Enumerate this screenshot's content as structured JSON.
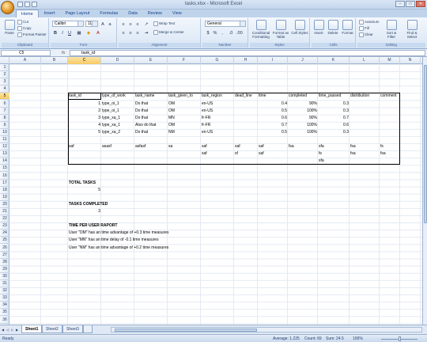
{
  "window": {
    "title": "tasks.xlsx - Microsoft Excel"
  },
  "ribbon_tabs": [
    "Home",
    "Insert",
    "Page Layout",
    "Formulas",
    "Data",
    "Review",
    "View"
  ],
  "active_tab": "Home",
  "ribbon": {
    "clipboard": {
      "paste": "Paste",
      "cut": "Cut",
      "copy": "Copy",
      "format_painter": "Format Painter",
      "label": "Clipboard"
    },
    "font": {
      "name": "Calibri",
      "size": "11",
      "label": "Font"
    },
    "alignment": {
      "wrap_text": "Wrap Text",
      "merge_center": "Merge & Center",
      "label": "Alignment"
    },
    "number": {
      "format": "General",
      "label": "Number"
    },
    "styles": {
      "conditional": "Conditional Formatting",
      "format_table": "Format as Table",
      "cell_styles": "Cell Styles",
      "label": "Styles"
    },
    "cells": {
      "insert": "Insert",
      "delete": "Delete",
      "format": "Format",
      "label": "Cells"
    },
    "editing": {
      "autosum": "AutoSum",
      "fill": "Fill",
      "clear": "Clear",
      "sort_filter": "Sort & Filter",
      "find_select": "Find & Select",
      "label": "Editing"
    }
  },
  "formula_bar": {
    "name_box": "C5",
    "fx": "fx",
    "content": "task_id"
  },
  "columns": [
    "A",
    "B",
    "C",
    "D",
    "E",
    "F",
    "G",
    "H",
    "I",
    "J",
    "K",
    "L",
    "M",
    "N",
    "O"
  ],
  "selected_column": "C",
  "selected_row": 5,
  "rows": [
    "1",
    "2",
    "3",
    "4",
    "5",
    "6",
    "7",
    "8",
    "9",
    "10",
    "11",
    "12",
    "13",
    "14",
    "15",
    "16",
    "17",
    "18",
    "19",
    "20",
    "21",
    "22",
    "23",
    "24",
    "25",
    "26",
    "27",
    "28",
    "29",
    "30",
    "31",
    "32",
    "33",
    "34",
    "35",
    "36"
  ],
  "cells": {
    "r5": [
      "task_id",
      "type_of_work",
      "task_name",
      "task_given_to",
      "task_region",
      "dead_line",
      "time",
      "completed",
      "time_passed",
      "distribution",
      "comment"
    ],
    "r6": [
      "1",
      "type_oi_1",
      "Do that",
      "OM",
      "en-US",
      "",
      "0.4",
      "90%",
      "0.3",
      "",
      ""
    ],
    "r7": [
      "2",
      "type_oi_1",
      "Do that",
      "OM",
      "en-US",
      "",
      "0.5",
      "100%",
      "0.3",
      "",
      ""
    ],
    "r8": [
      "3",
      "type_xa_1",
      "Do that",
      "MN",
      "fr-FR",
      "",
      "0.6",
      "90%",
      "0.7",
      "",
      ""
    ],
    "r9": [
      "4",
      "type_xa_1",
      "Also do that",
      "OM",
      "fr-FR",
      "",
      "0.7",
      "100%",
      "0.6",
      "",
      ""
    ],
    "r10": [
      "5",
      "type_xa_2",
      "Do that",
      "NM",
      "en-US",
      "",
      "0.5",
      "100%",
      "0.3",
      "",
      ""
    ],
    "r12": [
      "saf",
      "asasf",
      "asfasf",
      "sa",
      "saf",
      "saf",
      "saf",
      "fsa",
      "sfa",
      "fsa",
      "fs"
    ],
    "r13": [
      "",
      "",
      "",
      "",
      "saf",
      "sf",
      "saf",
      "",
      "fs",
      "fsa",
      "fsa"
    ],
    "r14": [
      "",
      "",
      "",
      "",
      "",
      "",
      "",
      "",
      "sfa",
      "",
      ""
    ],
    "r17": "TOTAL TASKS",
    "r18": "5",
    "r20": "TASKS COMPLETED",
    "r21": "3",
    "r23": "TIME PER USER RAPORT",
    "r24": "User \"OM\" has an time advantage of +0.3 time measures",
    "r25": "User \"MN\" has an time delay of -0.1 time measures",
    "r26": "User \"NM\" has an time advantage of +0.2 time measures"
  },
  "sheets": [
    "Sheet1",
    "Sheet2",
    "Sheet3"
  ],
  "active_sheet": "Sheet1",
  "status": {
    "ready": "Ready",
    "average": "Average: 1.225",
    "count": "Count: 69",
    "sum": "Sum: 24.5",
    "zoom": "100%"
  },
  "colors": {
    "accent": "#15428b",
    "ribbon_bg": "#d9e6f5",
    "selection": "#f6c964"
  }
}
